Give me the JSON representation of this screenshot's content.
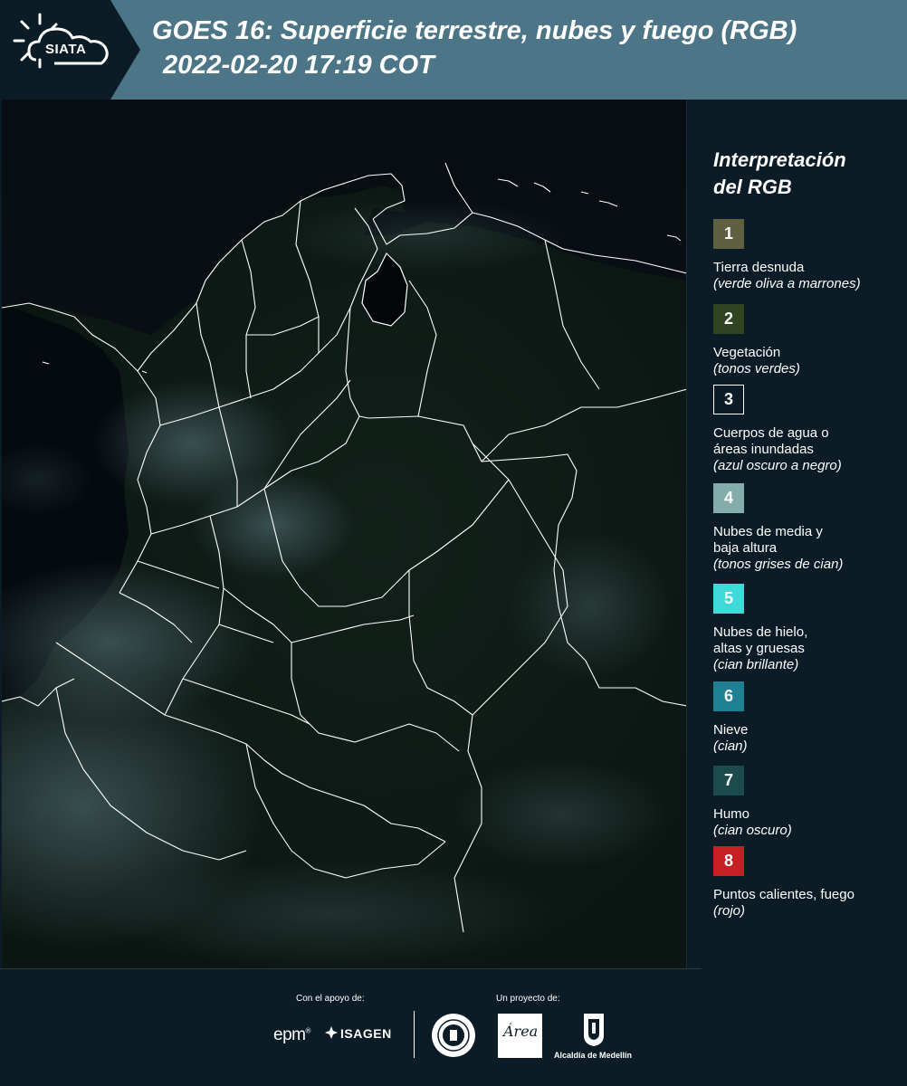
{
  "header": {
    "logo_text": "SIATA",
    "title": "GOES 16: Superficie terrestre, nubes y fuego (RGB)",
    "subtitle": "2022-02-20 17:19 COT"
  },
  "legend": {
    "title_line1": "Interpretación",
    "title_line2": "del RGB",
    "items": [
      {
        "number": "1",
        "color": "#5f5f41",
        "label_lines": [
          "Tierra desnuda"
        ],
        "desc": "(verde oliva a marrones)"
      },
      {
        "number": "2",
        "color": "#2f4521",
        "label_lines": [
          "Vegetación"
        ],
        "desc": "(tonos verdes)"
      },
      {
        "number": "3",
        "color": "#0b1c27",
        "label_lines": [
          "Cuerpos de agua o",
          "áreas inundadas"
        ],
        "desc": "(azul oscuro a negro)"
      },
      {
        "number": "4",
        "color": "#84acaa",
        "label_lines": [
          "Nubes de media y",
          "baja altura"
        ],
        "desc": "(tonos grises de cian)"
      },
      {
        "number": "5",
        "color": "#3fd9d9",
        "label_lines": [
          "Nubes de hielo,",
          "altas y gruesas"
        ],
        "desc": "(cian brillante)"
      },
      {
        "number": "6",
        "color": "#1f7f93",
        "label_lines": [
          "Nieve"
        ],
        "desc": "(cian)"
      },
      {
        "number": "7",
        "color": "#1c4b4d",
        "label_lines": [
          "Humo"
        ],
        "desc": "(cian oscuro)"
      },
      {
        "number": "8",
        "color": "#c62024",
        "label_lines": [
          "Puntos calientes, fuego"
        ],
        "desc": "(rojo)"
      }
    ]
  },
  "footer": {
    "support_label": "Con el apoyo de:",
    "project_label": "Un proyecto de:",
    "epm": "epm",
    "isagen": "ISAGEN",
    "area_logo": "Área",
    "alcaldia": "Alcaldía de Medellín"
  },
  "colors": {
    "header_bg": "#4c7587",
    "logo_bg": "#0b1c27",
    "page_bg": "#0b1c27",
    "map_bg": "#050a0e",
    "border_line": "#ffffff"
  }
}
